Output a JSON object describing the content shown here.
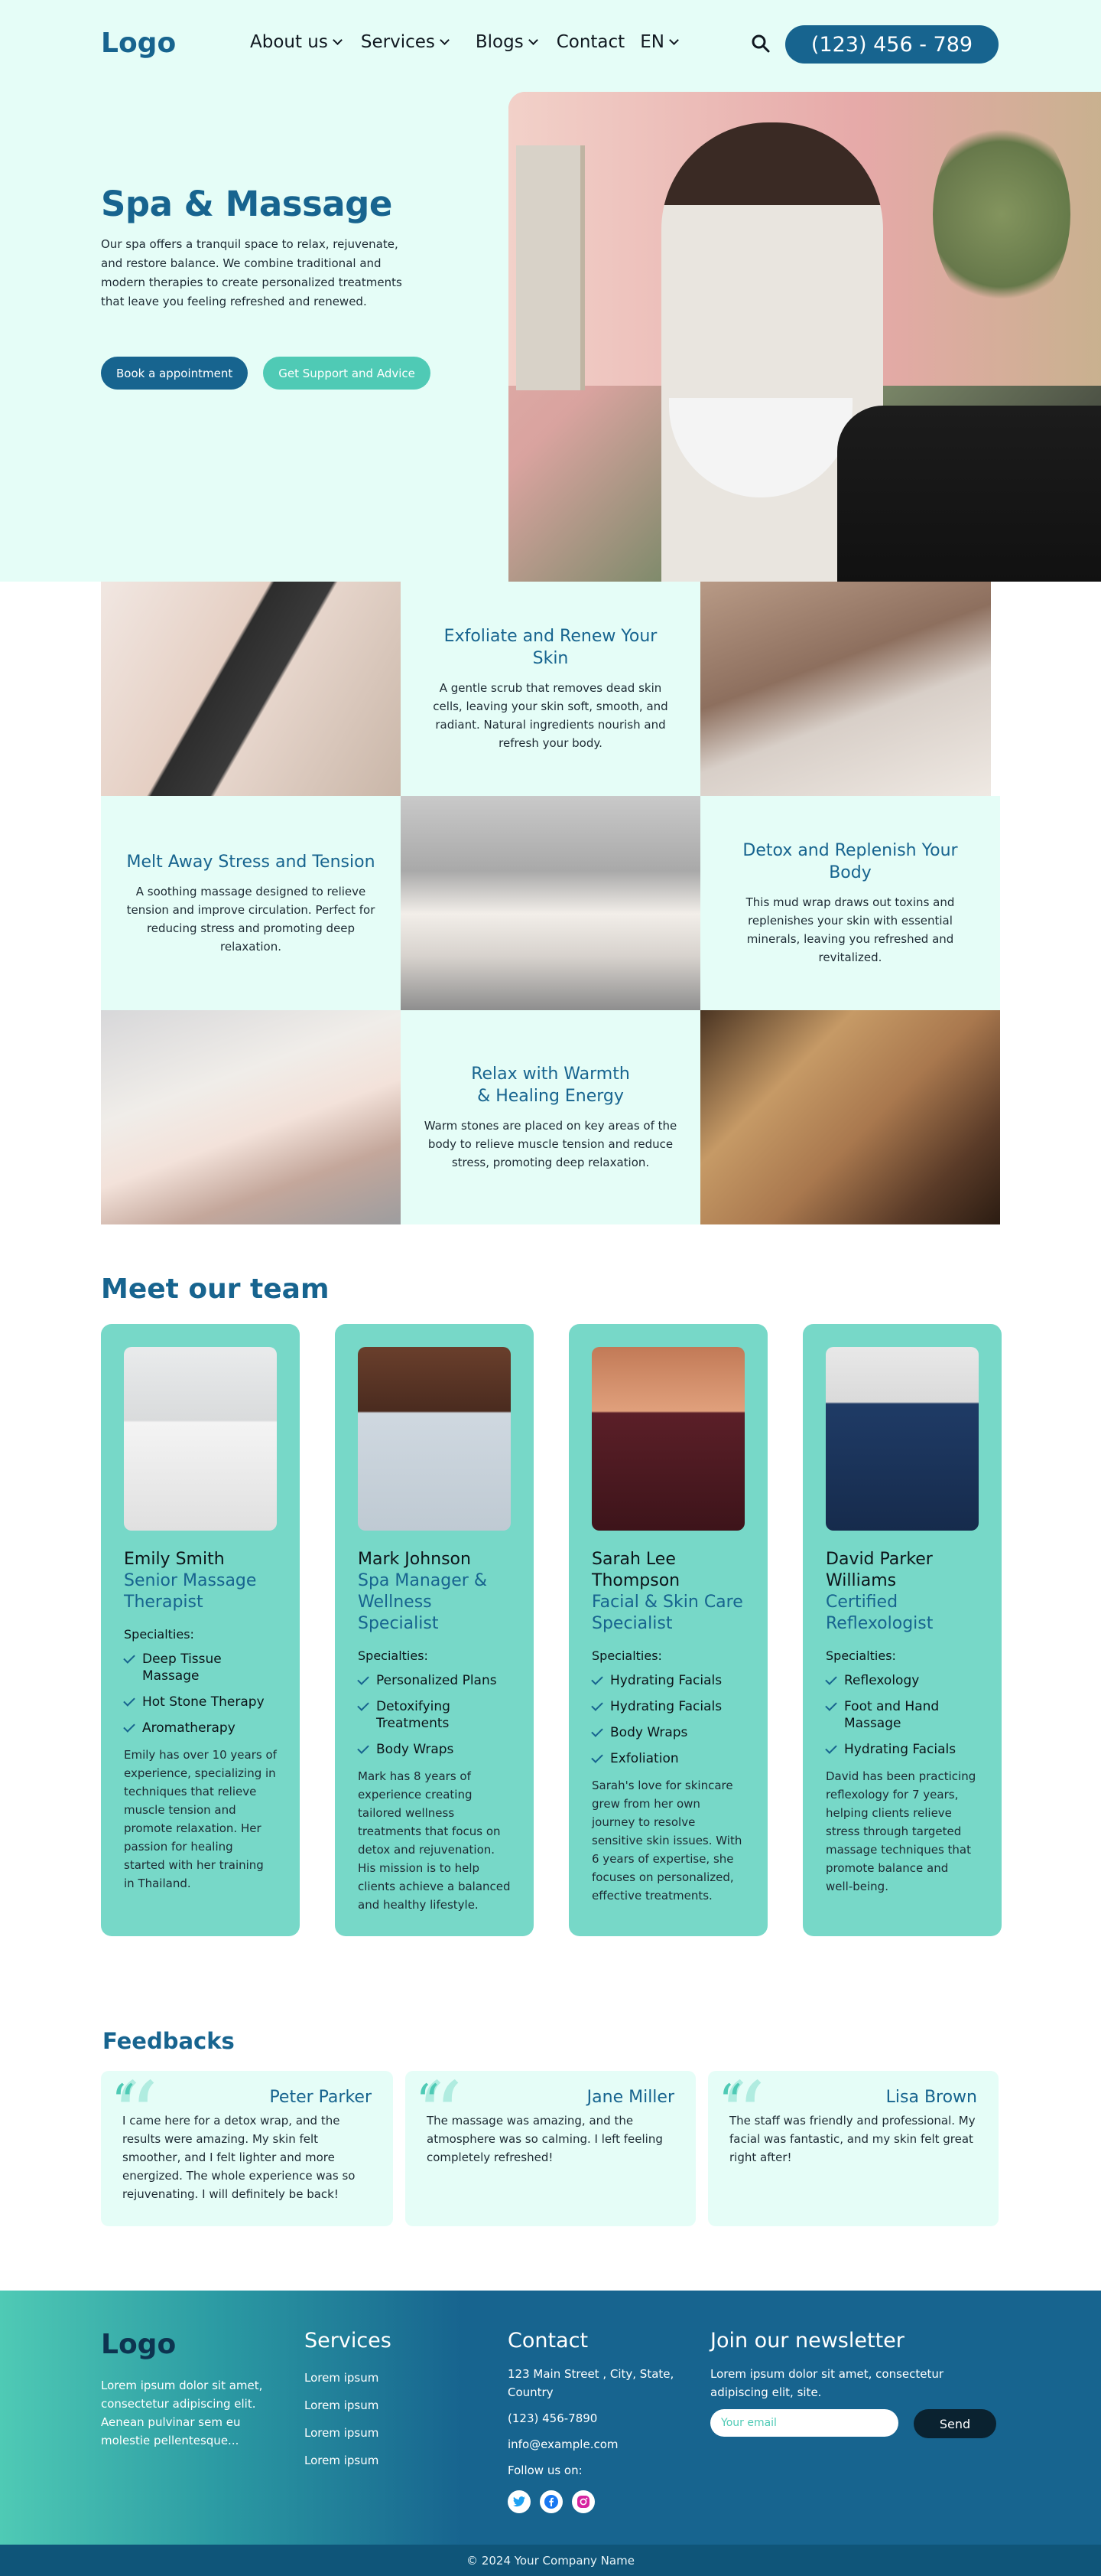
{
  "header": {
    "logo": "Logo",
    "nav": [
      {
        "label": "About us",
        "has_dropdown": true
      },
      {
        "label": "Services",
        "has_dropdown": true
      },
      {
        "label": "Blogs",
        "has_dropdown": true
      },
      {
        "label": "Contact",
        "has_dropdown": false
      },
      {
        "label": "EN",
        "has_dropdown": true
      }
    ],
    "search_icon": "search-icon",
    "phone": "(123) 456 - 789"
  },
  "hero": {
    "title": "Spa & Massage",
    "description": "Our spa offers a tranquil space to relax, rejuvenate, and restore balance. We combine traditional and modern therapies to create personalized treatments that leave you feeling refreshed and renewed.",
    "primary_button": "Book a appointment",
    "secondary_button": "Get Support and Advice"
  },
  "services": [
    {
      "title": "Exfoliate and Renew Your Skin",
      "description": "A gentle scrub that removes dead skin cells, leaving your skin soft, smooth, and radiant. Natural ingredients nourish and refresh your body."
    },
    {
      "title": "Melt Away Stress and Tension",
      "description": "A soothing massage designed to relieve tension and improve circulation. Perfect for reducing stress and promoting deep relaxation."
    },
    {
      "title": "Detox and Replenish Your Body",
      "description": "This mud wrap draws out toxins and replenishes your skin with essential minerals, leaving you refreshed and revitalized."
    },
    {
      "title": "Relax with Warmth & Healing Energy",
      "description": "Warm stones are placed on key areas of the body to relieve muscle tension and reduce stress, promoting deep relaxation."
    }
  ],
  "team": {
    "title": "Meet our team",
    "specialties_label": "Specialties:",
    "members": [
      {
        "name": "Emily Smith",
        "role": "Senior Massage Therapist",
        "specialties": [
          "Deep Tissue Massage",
          "Hot Stone Therapy",
          "Aromatherapy"
        ],
        "bio": "Emily has over 10 years of experience, specializing in techniques that relieve muscle tension and promote relaxation. Her passion for healing started with her training in Thailand."
      },
      {
        "name": " Mark Johnson",
        "role": "Spa Manager & Wellness Specialist",
        "specialties": [
          "Personalized Plans",
          "Detoxifying Treatments",
          "Body Wraps"
        ],
        "bio": "Mark has 8 years of experience creating tailored wellness treatments that focus on detox and rejuvenation. His mission is to help clients achieve a balanced and healthy lifestyle."
      },
      {
        "name": "Sarah Lee Thompson",
        "role": "Facial & Skin Care Specialist",
        "specialties": [
          "Hydrating Facials",
          "Hydrating Facials",
          "Body Wraps",
          "Exfoliation"
        ],
        "bio": "Sarah's love for skincare grew from her own journey to resolve sensitive skin issues. With 6 years of expertise, she focuses on personalized, effective treatments."
      },
      {
        "name": "David Parker Williams",
        "role": "Certified Reflexologist",
        "specialties": [
          "Reflexology",
          "Foot and Hand Massage",
          "Hydrating Facials"
        ],
        "bio": "David has been practicing reflexology for 7 years, helping clients relieve stress through targeted massage techniques that promote balance and well-being."
      }
    ]
  },
  "feedbacks": {
    "title": "Feedbacks",
    "items": [
      {
        "name": "Peter Parker",
        "text": "I came here for a detox wrap, and the results were amazing. My skin felt smoother, and I felt lighter and more energized. The whole experience was so rejuvenating. I will definitely be back!"
      },
      {
        "name": "Jane Miller",
        "text": "The massage was amazing, and the atmosphere was so calming. I left feeling completely refreshed!"
      },
      {
        "name": "Lisa Brown",
        "text": "The staff was friendly and professional. My facial was fantastic, and my skin felt great right after!"
      }
    ]
  },
  "footer": {
    "logo": "Logo",
    "about": "Lorem ipsum dolor sit amet, consectetur adipiscing elit. Aenean pulvinar sem eu molestie pellentesque...",
    "services_title": "Services",
    "services_links": [
      "Lorem ipsum",
      "Lorem ipsum",
      "Lorem ipsum",
      "Lorem ipsum"
    ],
    "contact_title": "Contact",
    "address": "123 Main Street , City, State, Country",
    "phone": "(123) 456-7890",
    "email": "info@example.com",
    "follow": "Follow us on:",
    "social": [
      "twitter-icon",
      "facebook-icon",
      "instagram-icon"
    ],
    "newsletter_title": "Join our newsletter",
    "newsletter_text": "Lorem ipsum dolor sit amet, consectetur adipiscing elit, site.",
    "email_placeholder": "Your email",
    "send_button": "Send",
    "copyright": "© 2024 Your Company Name"
  },
  "colors": {
    "primary": "#17648f",
    "accent": "#4fcab5",
    "card": "#77d8c8",
    "light": "#e5fdf7"
  }
}
